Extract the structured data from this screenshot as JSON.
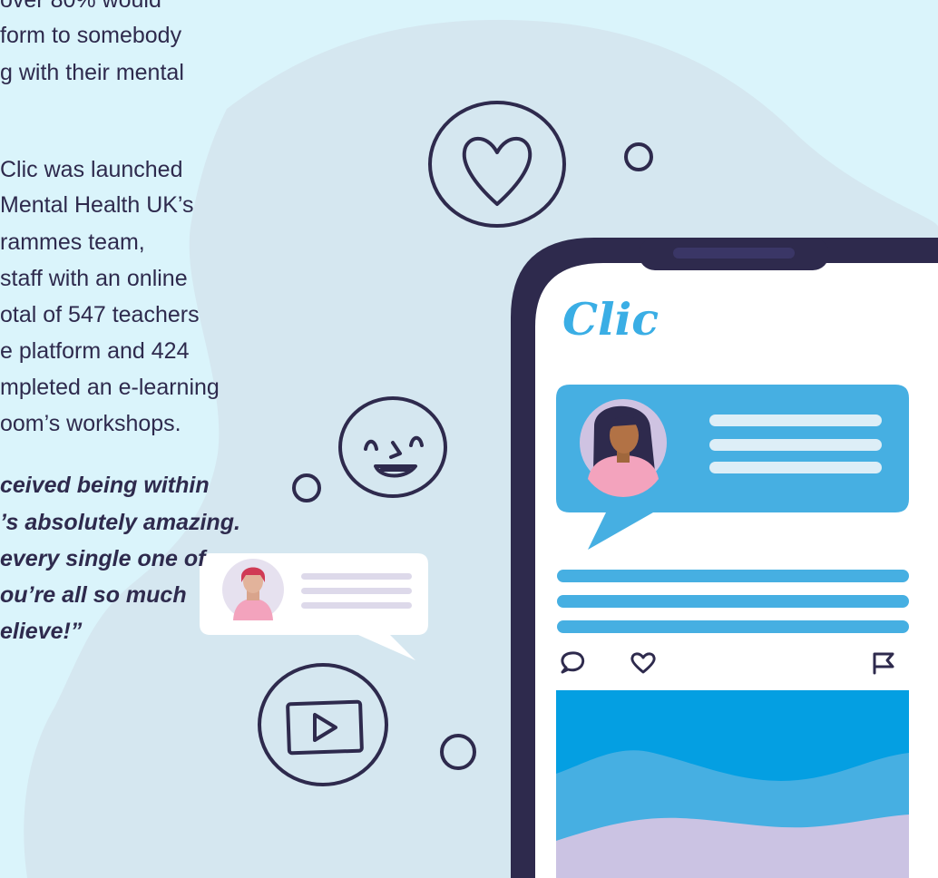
{
  "background_colors": {
    "page": "#daf4fb",
    "blob": "#d5e7f0",
    "ink": "#2e2a4d",
    "accent": "#3aaee5",
    "purple": "#cbc3e3"
  },
  "article": {
    "paragraph1_lines": [
      "over 80% would",
      "form to somebody",
      "g with their mental"
    ],
    "paragraph2_lines": [
      "Clic was launched",
      "Mental Health UK’s",
      "rammes team,",
      "staff with an online",
      "otal of 547 teachers",
      "e platform and 424",
      "mpleted an e-learning",
      "oom’s workshops."
    ],
    "quote_lines": [
      "ceived being within",
      "’s absolutely amazing.",
      "every single one of",
      "ou’re all so much",
      "elieve!”"
    ]
  },
  "phone": {
    "app_logo": "Clic"
  },
  "icons": [
    "heart-bubble-icon",
    "smiley-face-icon",
    "video-play-icon",
    "chat-bubble-icon",
    "heart-icon",
    "flag-icon",
    "avatar-icon"
  ]
}
